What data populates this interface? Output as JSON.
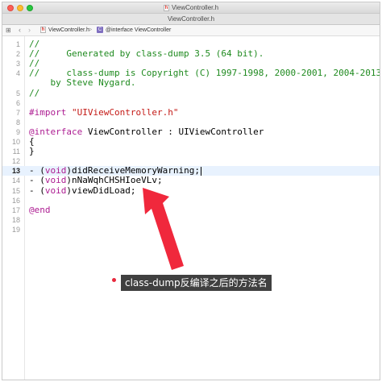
{
  "window": {
    "title": "ViewController.h",
    "tab_label": "ViewController.h"
  },
  "jump_bar": {
    "file": "ViewController.h",
    "separator": ">",
    "class_symbol": "@interface ViewController",
    "class_badge": "C",
    "file_badge": "h"
  },
  "code_lines": [
    {
      "num": "1",
      "text": "//"
    },
    {
      "num": "2",
      "text": "//     Generated by class-dump 3.5 (64 bit)."
    },
    {
      "num": "3",
      "text": "//"
    },
    {
      "num": "4",
      "text": "//     class-dump is Copyright (C) 1997-1998, 2000-2001, 2004-2013"
    },
    {
      "num": "",
      "text": "    by Steve Nygard."
    },
    {
      "num": "5",
      "text": "//"
    },
    {
      "num": "6",
      "text": ""
    },
    {
      "num": "7",
      "text": "#import \"UIViewController.h\""
    },
    {
      "num": "8",
      "text": ""
    },
    {
      "num": "9",
      "kw": "@interface",
      "text": " ViewController : UIViewController"
    },
    {
      "num": "10",
      "text": "{"
    },
    {
      "num": "11",
      "text": "}"
    },
    {
      "num": "12",
      "text": ""
    },
    {
      "num": "13",
      "pre": "- (",
      "kw": "void",
      "text": ")didReceiveMemoryWarning;"
    },
    {
      "num": "14",
      "pre": "- (",
      "kw": "void",
      "text": ")nNaWqhCHSHIoeVLv;"
    },
    {
      "num": "15",
      "pre": "- (",
      "kw": "void",
      "text": ")viewDidLoad;"
    },
    {
      "num": "16",
      "text": ""
    },
    {
      "num": "17",
      "kw": "@end",
      "text": ""
    },
    {
      "num": "18",
      "text": ""
    },
    {
      "num": "19",
      "text": ""
    }
  ],
  "annotation": {
    "text": "class-dump反编译之后的方法名"
  },
  "colors": {
    "comment": "#1f8a1f",
    "keyword": "#ad1d92",
    "string": "#c41a16",
    "arrow": "#f0283c",
    "current_line": "#e8f2fe"
  }
}
